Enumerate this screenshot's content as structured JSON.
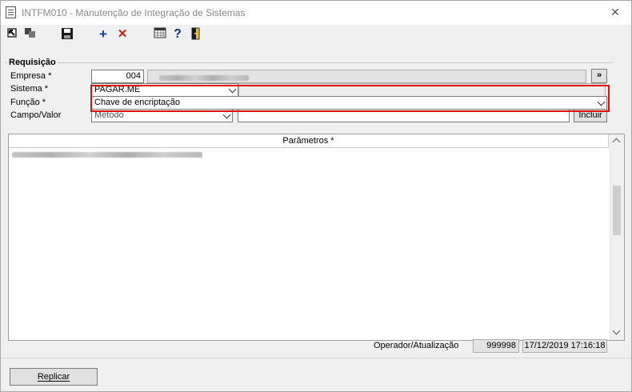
{
  "window": {
    "title": "INTFM010 - Manutenção de Integração de Sistemas",
    "close_glyph": "✕"
  },
  "toolbar": {
    "icons": [
      "select-icon",
      "copy-icon",
      "save-icon",
      "add-icon",
      "delete-icon",
      "calendar-grid-icon",
      "help-icon",
      "exit-door-icon"
    ],
    "add_glyph": "+",
    "delete_glyph": "✕",
    "help_glyph": "?"
  },
  "requisicao": {
    "group_title": "Requisição",
    "empresa_label": "Empresa *",
    "empresa_code": "004",
    "empresa_lookup_button": "»",
    "sistema_label": "Sistema *",
    "sistema_value": "PAGAR.ME",
    "funcao_label": "Função *",
    "funcao_value": "Chave de encriptação",
    "campo_valor_label": "Campo/Valor",
    "campo_value": "Método",
    "valor_value": "",
    "incluir_button": "Incluir"
  },
  "parametros": {
    "header": "Parâmetros *"
  },
  "status": {
    "operador_label": "Operador/Atualização",
    "operador_value": "999998",
    "atualizacao_value": "17/12/2019 17:16:18"
  },
  "footer": {
    "replicar_button": "Replicar"
  },
  "colors": {
    "highlight": "#e01010",
    "add_icon": "#1a3aa8",
    "delete_icon": "#d01818"
  }
}
